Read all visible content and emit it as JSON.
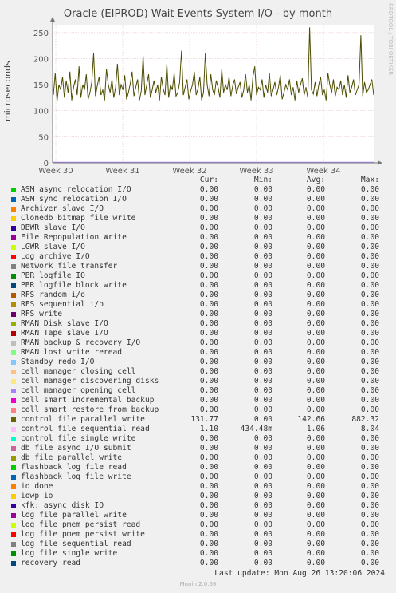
{
  "title": "Oracle (EIPROD) Wait Events System I/O - by month",
  "side_label": "RRDTOOL / TOBI OETIKER",
  "last_update": "Last update: Mon Aug 26 13:20:06 2024",
  "footer": "Munin 2.0.56",
  "headers": {
    "cur": "Cur:",
    "min": "Min:",
    "avg": "Avg:",
    "max": "Max:"
  },
  "chart_data": {
    "type": "line",
    "ylabel": "microseconds",
    "yticks": [
      0,
      50,
      100,
      150,
      200,
      250
    ],
    "ylim": [
      0,
      265
    ],
    "xticks": [
      "Week 30",
      "Week 31",
      "Week 32",
      "Week 33",
      "Week 34"
    ],
    "grid": true,
    "series": [
      {
        "name": "control file parallel write",
        "color": "#4d4d00",
        "values": [
          130,
          172,
          118,
          150,
          140,
          165,
          125,
          158,
          135,
          175,
          120,
          145,
          160,
          130,
          185,
          125,
          150,
          140,
          170,
          122,
          135,
          155,
          210,
          128,
          148,
          165,
          130,
          140,
          120,
          180,
          150,
          135,
          160,
          125,
          145,
          190,
          130,
          150,
          140,
          168,
          122,
          135,
          152,
          175,
          128,
          145,
          160,
          120,
          138,
          205,
          130,
          150,
          170,
          125,
          140,
          158,
          135,
          150,
          120,
          165,
          142,
          130,
          190,
          125,
          150,
          140,
          172,
          128,
          135,
          155,
          215,
          130,
          145,
          160,
          122,
          138,
          150,
          175,
          130,
          142,
          165,
          120,
          135,
          210,
          150,
          128,
          170,
          140,
          130,
          158,
          145,
          125,
          180,
          135,
          150,
          140,
          165,
          128,
          148,
          160,
          132,
          145,
          155,
          125,
          140,
          170,
          135,
          150,
          120,
          165,
          185,
          130,
          145,
          140,
          160,
          125,
          150,
          135,
          172,
          128,
          140,
          155,
          130,
          145,
          168,
          122,
          135,
          150,
          140,
          160,
          130,
          145,
          120,
          158,
          135,
          150,
          162,
          130,
          145,
          125,
          260,
          140,
          132,
          155,
          128,
          150,
          165,
          130,
          140,
          120,
          172,
          150,
          135,
          160,
          128,
          145,
          140,
          158,
          130,
          150,
          125,
          168,
          135,
          145,
          160,
          130,
          140,
          150,
          245,
          128,
          155,
          135,
          140,
          150,
          160,
          130
        ]
      }
    ]
  },
  "legend": [
    {
      "name": "ASM async relocation I/O",
      "color": "#00cc00",
      "cur": "0.00",
      "min": "0.00",
      "avg": "0.00",
      "max": "0.00"
    },
    {
      "name": "ASM sync relocation I/O",
      "color": "#0066b3",
      "cur": "0.00",
      "min": "0.00",
      "avg": "0.00",
      "max": "0.00"
    },
    {
      "name": "Archiver slave I/O",
      "color": "#ff8000",
      "cur": "0.00",
      "min": "0.00",
      "avg": "0.00",
      "max": "0.00"
    },
    {
      "name": "Clonedb bitmap file write",
      "color": "#ffcc00",
      "cur": "0.00",
      "min": "0.00",
      "avg": "0.00",
      "max": "0.00"
    },
    {
      "name": "DBWR slave I/O",
      "color": "#330099",
      "cur": "0.00",
      "min": "0.00",
      "avg": "0.00",
      "max": "0.00"
    },
    {
      "name": "File Repopulation Write",
      "color": "#990099",
      "cur": "0.00",
      "min": "0.00",
      "avg": "0.00",
      "max": "0.00"
    },
    {
      "name": "LGWR slave I/O",
      "color": "#ccff00",
      "cur": "0.00",
      "min": "0.00",
      "avg": "0.00",
      "max": "0.00"
    },
    {
      "name": "Log archive I/O",
      "color": "#ff0000",
      "cur": "0.00",
      "min": "0.00",
      "avg": "0.00",
      "max": "0.00"
    },
    {
      "name": "Network file transfer",
      "color": "#808080",
      "cur": "0.00",
      "min": "0.00",
      "avg": "0.00",
      "max": "0.00"
    },
    {
      "name": "PBR logfile IO",
      "color": "#008f00",
      "cur": "0.00",
      "min": "0.00",
      "avg": "0.00",
      "max": "0.00"
    },
    {
      "name": "PBR logfile block write",
      "color": "#00487d",
      "cur": "0.00",
      "min": "0.00",
      "avg": "0.00",
      "max": "0.00"
    },
    {
      "name": "RFS random i/o",
      "color": "#b35a00",
      "cur": "0.00",
      "min": "0.00",
      "avg": "0.00",
      "max": "0.00"
    },
    {
      "name": "RFS sequential i/o",
      "color": "#b38f00",
      "cur": "0.00",
      "min": "0.00",
      "avg": "0.00",
      "max": "0.00"
    },
    {
      "name": "RFS write",
      "color": "#6b006b",
      "cur": "0.00",
      "min": "0.00",
      "avg": "0.00",
      "max": "0.00"
    },
    {
      "name": "RMAN Disk slave I/O",
      "color": "#8fb300",
      "cur": "0.00",
      "min": "0.00",
      "avg": "0.00",
      "max": "0.00"
    },
    {
      "name": "RMAN Tape slave I/O",
      "color": "#b30000",
      "cur": "0.00",
      "min": "0.00",
      "avg": "0.00",
      "max": "0.00"
    },
    {
      "name": "RMAN backup & recovery I/O",
      "color": "#bebebe",
      "cur": "0.00",
      "min": "0.00",
      "avg": "0.00",
      "max": "0.00"
    },
    {
      "name": "RMAN lost write reread",
      "color": "#80ff80",
      "cur": "0.00",
      "min": "0.00",
      "avg": "0.00",
      "max": "0.00"
    },
    {
      "name": "Standby redo I/O",
      "color": "#80c9ff",
      "cur": "0.00",
      "min": "0.00",
      "avg": "0.00",
      "max": "0.00"
    },
    {
      "name": "cell manager closing cell",
      "color": "#ffc080",
      "cur": "0.00",
      "min": "0.00",
      "avg": "0.00",
      "max": "0.00"
    },
    {
      "name": "cell manager discovering disks",
      "color": "#ffe680",
      "cur": "0.00",
      "min": "0.00",
      "avg": "0.00",
      "max": "0.00"
    },
    {
      "name": "cell manager opening cell",
      "color": "#aa80ff",
      "cur": "0.00",
      "min": "0.00",
      "avg": "0.00",
      "max": "0.00"
    },
    {
      "name": "cell smart incremental backup",
      "color": "#ee00cc",
      "cur": "0.00",
      "min": "0.00",
      "avg": "0.00",
      "max": "0.00"
    },
    {
      "name": "cell smart restore from backup",
      "color": "#ff8080",
      "cur": "0.00",
      "min": "0.00",
      "avg": "0.00",
      "max": "0.00"
    },
    {
      "name": "control file parallel write",
      "color": "#666600",
      "cur": "131.77",
      "min": "0.00",
      "avg": "142.66",
      "max": "882.32"
    },
    {
      "name": "control file sequential read",
      "color": "#ffbfff",
      "cur": "1.10",
      "min": "434.48m",
      "avg": "1.06",
      "max": "8.04"
    },
    {
      "name": "control file single write",
      "color": "#00ffcc",
      "cur": "0.00",
      "min": "0.00",
      "avg": "0.00",
      "max": "0.00"
    },
    {
      "name": "db file async I/O submit",
      "color": "#cc6699",
      "cur": "0.00",
      "min": "0.00",
      "avg": "0.00",
      "max": "0.00"
    },
    {
      "name": "db file parallel write",
      "color": "#999900",
      "cur": "0.00",
      "min": "0.00",
      "avg": "0.00",
      "max": "0.00"
    },
    {
      "name": "flashback log file read",
      "color": "#00cc00",
      "cur": "0.00",
      "min": "0.00",
      "avg": "0.00",
      "max": "0.00"
    },
    {
      "name": "flashback log file write",
      "color": "#0066b3",
      "cur": "0.00",
      "min": "0.00",
      "avg": "0.00",
      "max": "0.00"
    },
    {
      "name": "io done",
      "color": "#ff8000",
      "cur": "0.00",
      "min": "0.00",
      "avg": "0.00",
      "max": "0.00"
    },
    {
      "name": "iowp io",
      "color": "#ffcc00",
      "cur": "0.00",
      "min": "0.00",
      "avg": "0.00",
      "max": "0.00"
    },
    {
      "name": "kfk: async disk IO",
      "color": "#330099",
      "cur": "0.00",
      "min": "0.00",
      "avg": "0.00",
      "max": "0.00"
    },
    {
      "name": "log file parallel write",
      "color": "#990099",
      "cur": "0.00",
      "min": "0.00",
      "avg": "0.00",
      "max": "0.00"
    },
    {
      "name": "log file pmem persist read",
      "color": "#ccff00",
      "cur": "0.00",
      "min": "0.00",
      "avg": "0.00",
      "max": "0.00"
    },
    {
      "name": "log file pmem persist write",
      "color": "#ff0000",
      "cur": "0.00",
      "min": "0.00",
      "avg": "0.00",
      "max": "0.00"
    },
    {
      "name": "log file sequential read",
      "color": "#808080",
      "cur": "0.00",
      "min": "0.00",
      "avg": "0.00",
      "max": "0.00"
    },
    {
      "name": "log file single write",
      "color": "#008f00",
      "cur": "0.00",
      "min": "0.00",
      "avg": "0.00",
      "max": "0.00"
    },
    {
      "name": "recovery read",
      "color": "#00487d",
      "cur": "0.00",
      "min": "0.00",
      "avg": "0.00",
      "max": "0.00"
    }
  ]
}
